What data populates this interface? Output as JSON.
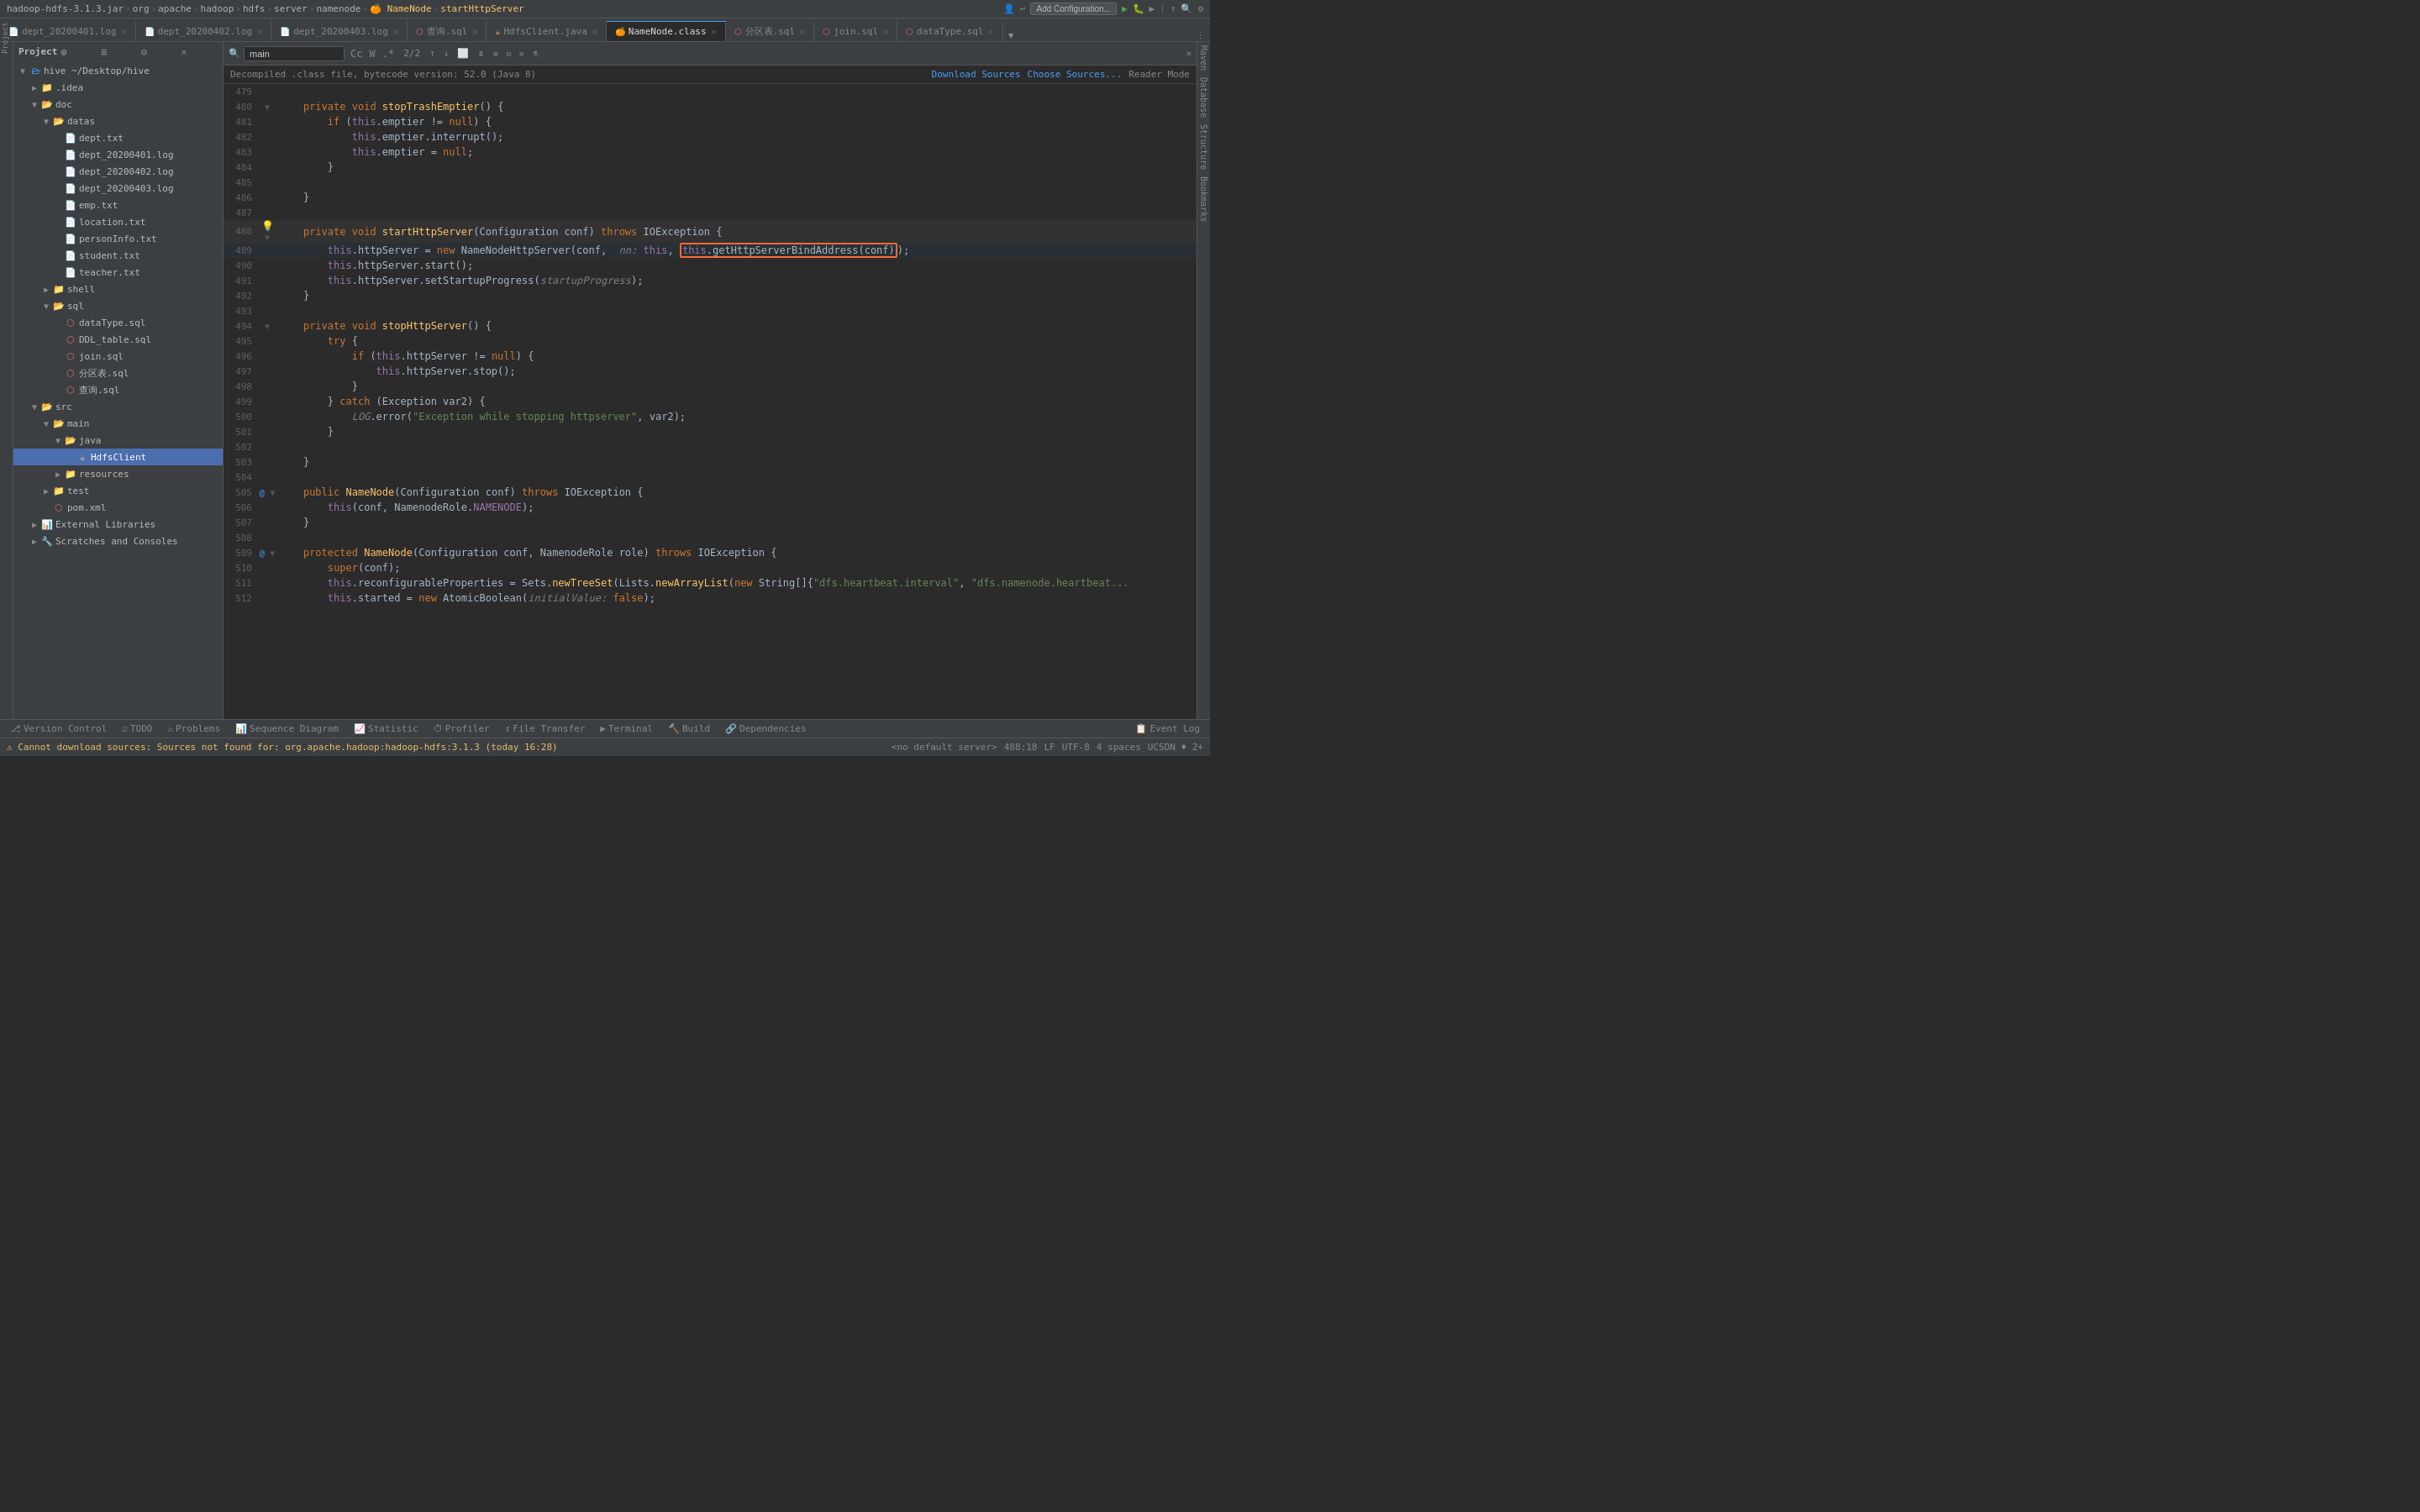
{
  "titlebar": {
    "breadcrumb": [
      {
        "text": "hadoop-hdfs-3.1.3.jar",
        "active": false
      },
      {
        "text": "org",
        "active": false
      },
      {
        "text": "apache",
        "active": false
      },
      {
        "text": "hadoop",
        "active": false
      },
      {
        "text": "hdfs",
        "active": false
      },
      {
        "text": "server",
        "active": false
      },
      {
        "text": "namenode",
        "active": false
      },
      {
        "text": "NameNode",
        "active": false,
        "icon": "java"
      },
      {
        "text": "startHttpServer",
        "active": true
      }
    ]
  },
  "tabs": [
    {
      "label": "dept_20200401.log",
      "type": "log",
      "active": false
    },
    {
      "label": "dept_20200402.log",
      "type": "log",
      "active": false
    },
    {
      "label": "dept_20200403.log",
      "type": "log",
      "active": false
    },
    {
      "label": "查询.sql",
      "type": "sql",
      "active": false
    },
    {
      "label": "HdfsClient.java",
      "type": "java",
      "active": false
    },
    {
      "label": "NameNode.class",
      "type": "class",
      "active": true
    },
    {
      "label": "分区表.sql",
      "type": "sql",
      "active": false
    },
    {
      "label": "join.sql",
      "type": "sql",
      "active": false
    },
    {
      "label": "dataType.sql",
      "type": "sql",
      "active": false
    }
  ],
  "info_bar": {
    "text": "Decompiled .class file, bytecode version: 52.0 (Java 8)",
    "download_sources": "Download Sources",
    "choose_sources": "Choose Sources...",
    "reader_mode": "Reader Mode"
  },
  "search": {
    "value": "main",
    "count": "2/2"
  },
  "sidebar": {
    "title": "Project",
    "items": [
      {
        "label": "hive ~/Desktop/hive",
        "level": 0,
        "type": "root",
        "expanded": true
      },
      {
        "label": ".idea",
        "level": 1,
        "type": "folder",
        "expanded": false
      },
      {
        "label": "doc",
        "level": 1,
        "type": "folder",
        "expanded": true
      },
      {
        "label": "datas",
        "level": 2,
        "type": "folder",
        "expanded": true
      },
      {
        "label": "dept.txt",
        "level": 3,
        "type": "txt"
      },
      {
        "label": "dept_20200401.log",
        "level": 3,
        "type": "log"
      },
      {
        "label": "dept_20200402.log",
        "level": 3,
        "type": "log"
      },
      {
        "label": "dept_20200403.log",
        "level": 3,
        "type": "log"
      },
      {
        "label": "emp.txt",
        "level": 3,
        "type": "txt"
      },
      {
        "label": "location.txt",
        "level": 3,
        "type": "txt"
      },
      {
        "label": "personInfo.txt",
        "level": 3,
        "type": "txt"
      },
      {
        "label": "student.txt",
        "level": 3,
        "type": "txt"
      },
      {
        "label": "teacher.txt",
        "level": 3,
        "type": "txt"
      },
      {
        "label": "shell",
        "level": 2,
        "type": "folder",
        "expanded": false
      },
      {
        "label": "sql",
        "level": 2,
        "type": "folder",
        "expanded": true
      },
      {
        "label": "dataType.sql",
        "level": 3,
        "type": "sql"
      },
      {
        "label": "DDL_table.sql",
        "level": 3,
        "type": "sql"
      },
      {
        "label": "join.sql",
        "level": 3,
        "type": "sql"
      },
      {
        "label": "分区表.sql",
        "level": 3,
        "type": "sql"
      },
      {
        "label": "查询.sql",
        "level": 3,
        "type": "sql"
      },
      {
        "label": "src",
        "level": 1,
        "type": "folder",
        "expanded": true
      },
      {
        "label": "main",
        "level": 2,
        "type": "folder",
        "expanded": true
      },
      {
        "label": "java",
        "level": 3,
        "type": "folder",
        "expanded": true
      },
      {
        "label": "HdfsClient",
        "level": 4,
        "type": "java",
        "selected": true
      },
      {
        "label": "resources",
        "level": 3,
        "type": "folder",
        "expanded": false
      },
      {
        "label": "test",
        "level": 2,
        "type": "folder",
        "expanded": false
      },
      {
        "label": "pom.xml",
        "level": 2,
        "type": "xml"
      },
      {
        "label": "External Libraries",
        "level": 1,
        "type": "library",
        "expanded": false
      },
      {
        "label": "Scratches and Consoles",
        "level": 1,
        "type": "scratches",
        "expanded": false
      }
    ]
  },
  "code": {
    "lines": [
      {
        "num": 479,
        "code": "",
        "indent": 0
      },
      {
        "num": 480,
        "code": "    private void stopTrashEmptier() {",
        "indent": 1,
        "fold": true
      },
      {
        "num": 481,
        "code": "        if (this.emptier != null) {",
        "indent": 2
      },
      {
        "num": 482,
        "code": "            this.emptier.interrupt();",
        "indent": 3
      },
      {
        "num": 483,
        "code": "            this.emptier = null;",
        "indent": 3
      },
      {
        "num": 484,
        "code": "        }",
        "indent": 2
      },
      {
        "num": 485,
        "code": "",
        "indent": 0
      },
      {
        "num": 486,
        "code": "    }",
        "indent": 1
      },
      {
        "num": 487,
        "code": "",
        "indent": 0
      },
      {
        "num": 488,
        "code": "    private void startHttpServer(Configuration conf) throws IOException {",
        "indent": 1,
        "bulb": true,
        "fold": true
      },
      {
        "num": 489,
        "code": "        this.httpServer = new NameNodeHttpServer(conf,  nn: this, this.getHttpServerBindAddress(conf));",
        "indent": 2,
        "highlight_range": [
          64,
          105
        ]
      },
      {
        "num": 490,
        "code": "        this.httpServer.start();",
        "indent": 2
      },
      {
        "num": 491,
        "code": "        this.httpServer.setStartupProgress(startupProgress);",
        "indent": 2
      },
      {
        "num": 492,
        "code": "    }",
        "indent": 1
      },
      {
        "num": 493,
        "code": "",
        "indent": 0
      },
      {
        "num": 494,
        "code": "    private void stopHttpServer() {",
        "indent": 1,
        "fold": true
      },
      {
        "num": 495,
        "code": "        try {",
        "indent": 2
      },
      {
        "num": 496,
        "code": "            if (this.httpServer != null) {",
        "indent": 3
      },
      {
        "num": 497,
        "code": "                this.httpServer.stop();",
        "indent": 4
      },
      {
        "num": 498,
        "code": "            }",
        "indent": 3
      },
      {
        "num": 499,
        "code": "        } catch (Exception var2) {",
        "indent": 2
      },
      {
        "num": 500,
        "code": "            LOG.error(\"Exception while stopping httpserver\", var2);",
        "indent": 3
      },
      {
        "num": 501,
        "code": "        }",
        "indent": 2
      },
      {
        "num": 502,
        "code": "",
        "indent": 0
      },
      {
        "num": 503,
        "code": "    }",
        "indent": 1
      },
      {
        "num": 504,
        "code": "",
        "indent": 0
      },
      {
        "num": 505,
        "code": "    public NameNode(Configuration conf) throws IOException {",
        "indent": 1,
        "annotation": "@",
        "fold": true
      },
      {
        "num": 506,
        "code": "        this(conf, NamenodeRole.NAMENODE);",
        "indent": 2
      },
      {
        "num": 507,
        "code": "    }",
        "indent": 1
      },
      {
        "num": 508,
        "code": "",
        "indent": 0
      },
      {
        "num": 509,
        "code": "    protected NameNode(Configuration conf, NamenodeRole role) throws IOException {",
        "indent": 1,
        "annotation": "@",
        "fold": true
      },
      {
        "num": 510,
        "code": "        super(conf);",
        "indent": 2
      },
      {
        "num": 511,
        "code": "        this.reconfigurableProperties = Sets.newTreeSet(Lists.newArrayList(new String[]{\"dfs.heartbeat.interval\", \"dfs.namenode.heartbeat...",
        "indent": 2
      },
      {
        "num": 512,
        "code": "        this.started = new AtomicBoolean(initialValue: false);",
        "indent": 2
      }
    ]
  },
  "bottom_tabs": [
    {
      "label": "Version Control",
      "icon": "git"
    },
    {
      "label": "TODO",
      "icon": "list"
    },
    {
      "label": "Problems",
      "icon": "warning"
    },
    {
      "label": "Sequence Diagram",
      "icon": "diagram"
    },
    {
      "label": "Statistic",
      "icon": "chart"
    },
    {
      "label": "Profiler",
      "icon": "profiler"
    },
    {
      "label": "File Transfer",
      "icon": "transfer"
    },
    {
      "label": "Terminal",
      "icon": "terminal"
    },
    {
      "label": "Build",
      "icon": "build"
    },
    {
      "label": "Dependencies",
      "icon": "deps"
    },
    {
      "label": "Event Log",
      "icon": "log"
    }
  ],
  "status_bar": {
    "left": {
      "warning": "Cannot download sources: Sources not found for: org.apache.hadoop:hadoop-hdfs:3.1.3 (today 16:28)"
    },
    "right": {
      "server": "<no default server>",
      "position": "488:18",
      "encoding": "LF",
      "charset": "UTF-8",
      "spaces": "4 spaces",
      "git": "UCSDN ♦ 2+"
    }
  },
  "right_panels": [
    "Maven",
    "Database",
    "Structure",
    "Bookmarks"
  ]
}
